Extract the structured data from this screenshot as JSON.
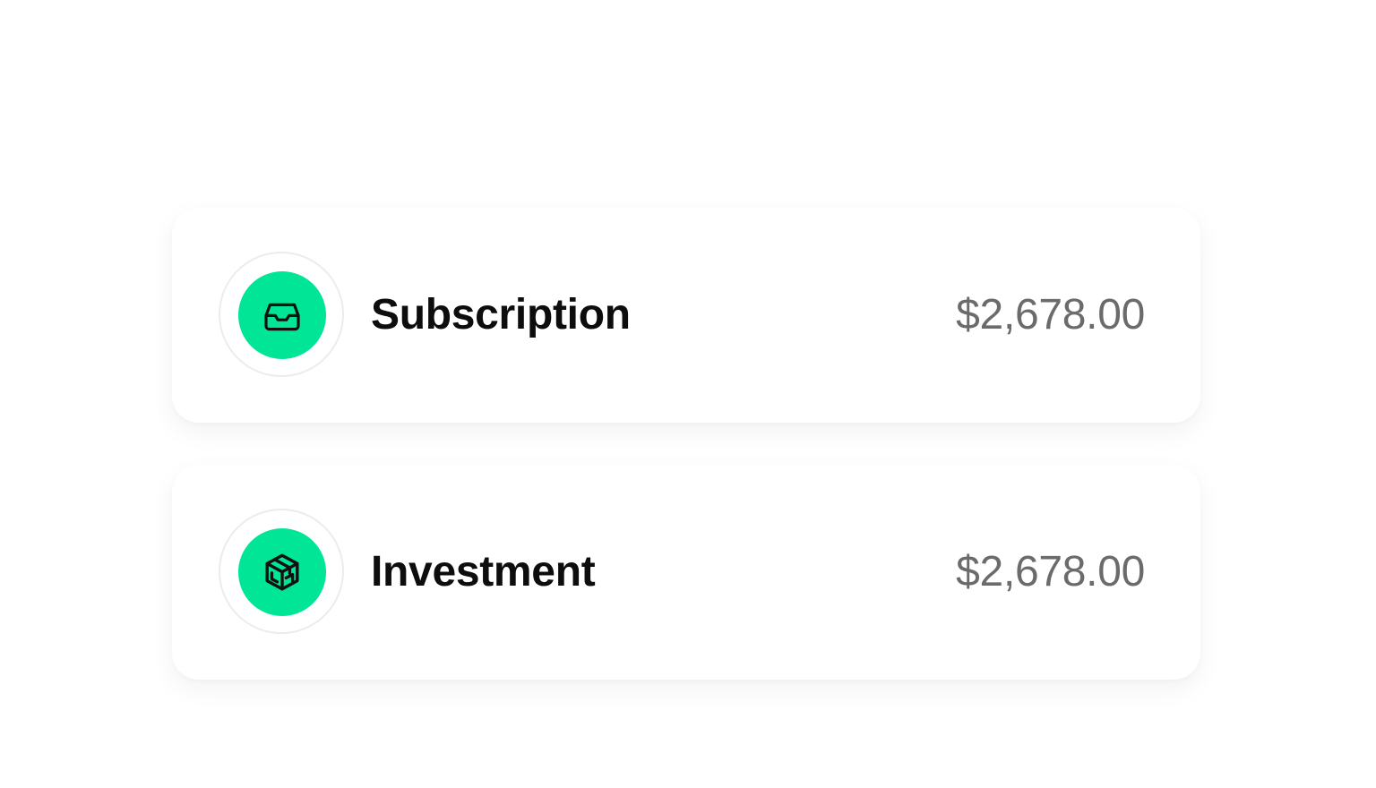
{
  "theme": {
    "accent": "#00E596",
    "label_color": "#0d0d0d",
    "amount_color": "#6b6b6b",
    "ring_border": "#ececec"
  },
  "transactions": [
    {
      "label": "Subscription",
      "amount": "$2,678.00",
      "icon": "inbox-tray-icon"
    },
    {
      "label": "Investment",
      "amount": "$2,678.00",
      "icon": "cube-box-icon"
    }
  ]
}
